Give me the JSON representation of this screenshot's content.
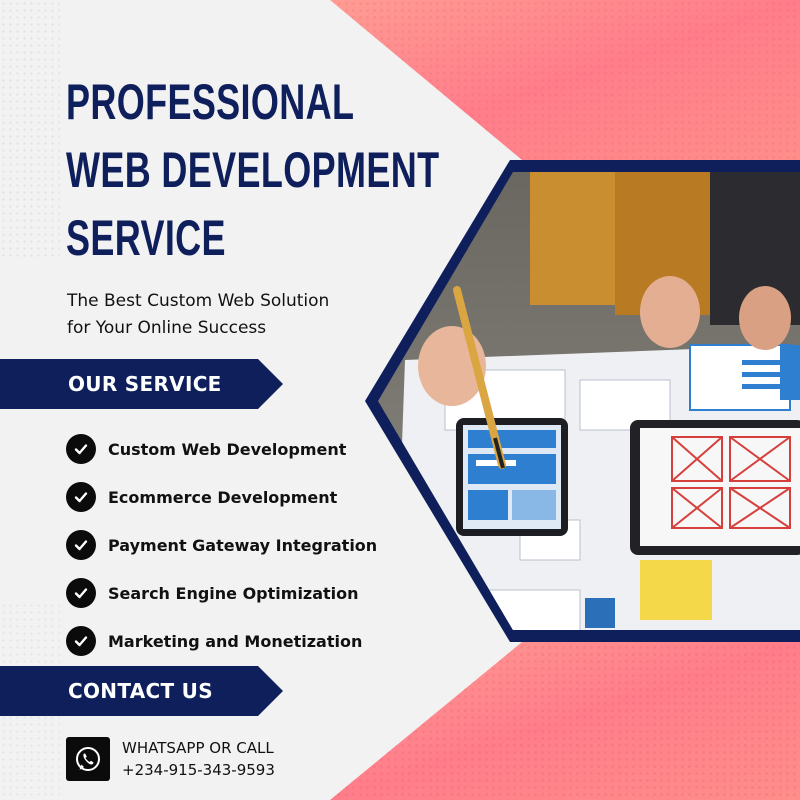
{
  "headline": {
    "line1": "PROFESSIONAL",
    "line2": "WEB DEVELOPMENT",
    "line3": "SERVICE"
  },
  "subtitle": {
    "line1": "The Best Custom Web Solution",
    "line2": "for Your Online Success"
  },
  "service_section": {
    "heading": "OUR SERVICE",
    "items": [
      {
        "label": "Custom Web Development",
        "icon": "check-circle-icon"
      },
      {
        "label": "Ecommerce Development",
        "icon": "check-circle-icon"
      },
      {
        "label": "Payment Gateway Integration",
        "icon": "check-circle-icon"
      },
      {
        "label": "Search Engine Optimization",
        "icon": "check-circle-icon"
      },
      {
        "label": "Marketing and Monetization",
        "icon": "check-circle-icon"
      }
    ]
  },
  "contact_section": {
    "heading": "CONTACT US",
    "channel": "WHATSAPP OR CALL",
    "phone": "+234-915-343-9593",
    "icon": "whatsapp-phone-icon"
  },
  "colors": {
    "navy": "#0e1f5b",
    "coral": "#ff7a86",
    "background": "#f2f2f2",
    "check_fill": "#0b0b0b"
  }
}
